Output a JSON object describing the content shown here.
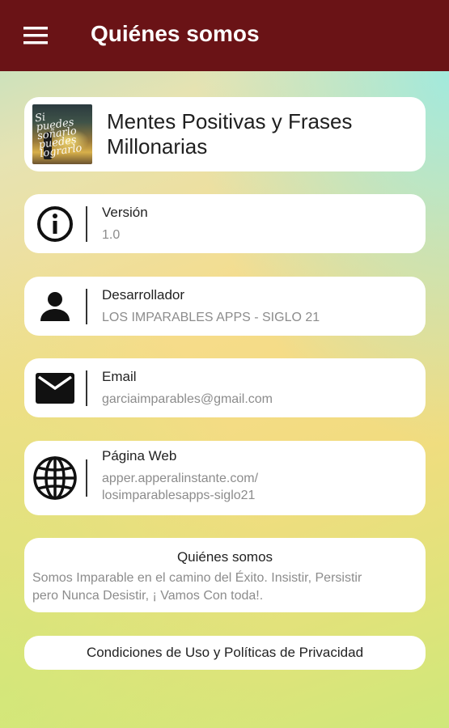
{
  "appbar": {
    "title": "Quiénes somos",
    "menu_icon": "hamburger-menu-icon"
  },
  "app": {
    "name": "Mentes Positivas y Frases Millonarias",
    "thumb_text": "Si puedes soñarlo puedes lograrlo"
  },
  "items": [
    {
      "icon": "info-icon",
      "label": "Versión",
      "value": "1.0"
    },
    {
      "icon": "person-icon",
      "label": "Desarrollador",
      "value": "LOS IMPARABLES APPS - SIGLO 21"
    },
    {
      "icon": "email-icon",
      "label": "Email",
      "value": "garciaimparables@gmail.com"
    },
    {
      "icon": "globe-icon",
      "label": "Página Web",
      "value_line1": "apper.apperalinstante.com/",
      "value_line2": "losimparablesapps-siglo21"
    }
  ],
  "about": {
    "title": "Quiénes somos",
    "text_line1": "Somos Imparable en el camino del Éxito. Insistir, Persistir",
    "text_line2": "pero Nunca Desistir, ¡ Vamos Con toda!."
  },
  "terms": {
    "label": "Condiciones de Uso y Políticas de Privacidad"
  },
  "colors": {
    "appbar": "#6a1316",
    "card": "#ffffff",
    "label": "#222222",
    "value": "#8c8c8c"
  }
}
